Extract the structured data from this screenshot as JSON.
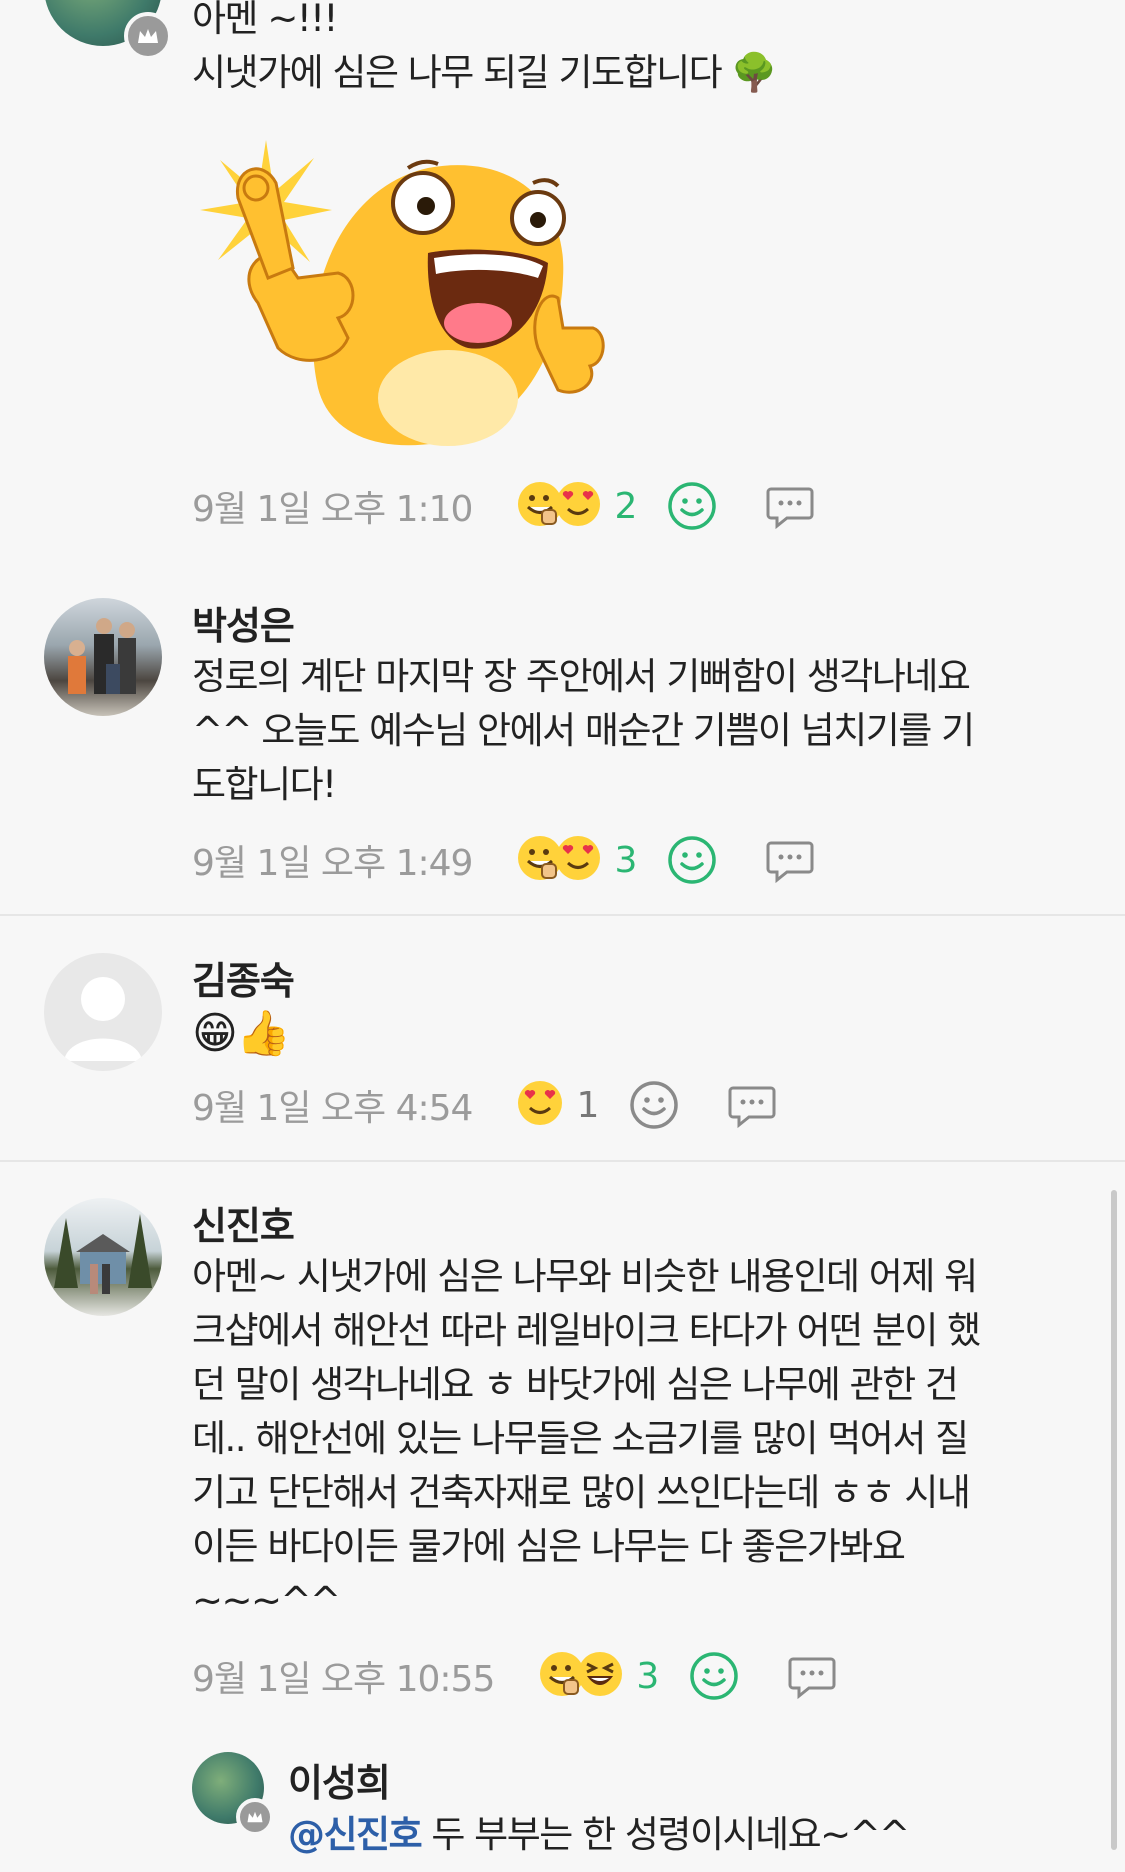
{
  "comments": [
    {
      "name": "",
      "lines": [
        "아멘 ~!!!",
        "시냇가에 심은 나무 되길 기도합니다 🌳"
      ],
      "time": "9월 1일 오후 1:10",
      "reaction_count": "2"
    },
    {
      "name": "박성은",
      "lines": [
        "정로의 계단 마지막 장 주안에서 기뻐함이 생각나네요",
        "^^ 오늘도 예수님 안에서 매순간 기쁨이 넘치기를 기",
        "도합니다!"
      ],
      "time": "9월 1일 오후 1:49",
      "reaction_count": "3"
    },
    {
      "name": "김종숙",
      "lines": [
        "😁👍"
      ],
      "time": "9월 1일 오후 4:54",
      "reaction_count": "1"
    },
    {
      "name": "신진호",
      "lines": [
        "아멘~ 시냇가에 심은 나무와 비슷한 내용인데 어제 워",
        "크샵에서 해안선 따라 레일바이크 타다가 어떤 분이 했",
        "던 말이 생각나네요 ㅎ 바닷가에 심은 나무에 관한 건",
        "데.. 해안선에 있는 나무들은 소금기를 많이 먹어서 질",
        "기고 단단해서 건축자재로 많이 쓰인다는데 ㅎㅎ 시내",
        "이든 바다이든 물가에 심은 나무는 다 좋은가봐요",
        "~~~^^"
      ],
      "time": "9월 1일 오후 10:55",
      "reaction_count": "3"
    },
    {
      "name": "이성희",
      "mention": "@신진호",
      "text": " 두 부부는 한 성령이시네요~^^"
    }
  ],
  "icons": {
    "reaction_a": "grinning-thumbs-icon",
    "reaction_b": "heart-eyes-icon",
    "reaction_c": "laughing-icon",
    "add_reaction": "smile-outline-icon",
    "reply": "speech-bubble-icon",
    "badge": "crown-icon"
  },
  "colors": {
    "reaction_count": "#2bb673",
    "mention": "#2d5fa8",
    "timestamp": "#9b9b9b"
  }
}
